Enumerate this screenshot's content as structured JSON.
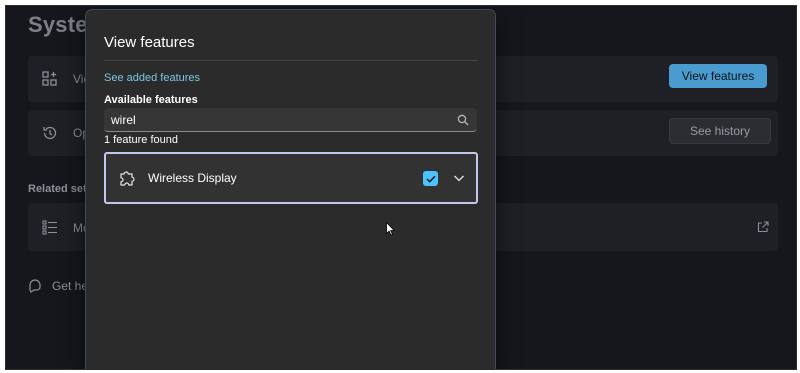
{
  "background": {
    "title": "Syster",
    "card1_label": "Vie",
    "view_features_button": "View features",
    "card2_label": "Op",
    "see_history_button": "See history",
    "related_settings": "Related sett",
    "card3_label": "Mo",
    "get_help": "Get hel"
  },
  "dialog": {
    "title": "View features",
    "see_added_link": "See added features",
    "available_label": "Available features",
    "search_value": "wirel",
    "result_count": "1 feature found",
    "feature": {
      "name": "Wireless Display",
      "checked": true
    }
  },
  "colors": {
    "accent": "#4cc2ff",
    "link": "#7cc7e4",
    "focus_ring": "#c3c7ee"
  }
}
